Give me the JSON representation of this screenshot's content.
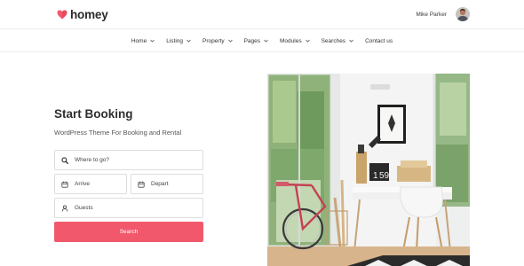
{
  "brand": {
    "name": "homey",
    "accent": "#f1586c"
  },
  "user": {
    "name": "Mike Parker"
  },
  "nav": [
    {
      "label": "Home",
      "has_dropdown": true
    },
    {
      "label": "Listing",
      "has_dropdown": true
    },
    {
      "label": "Property",
      "has_dropdown": true
    },
    {
      "label": "Pages",
      "has_dropdown": true
    },
    {
      "label": "Modules",
      "has_dropdown": true
    },
    {
      "label": "Searches",
      "has_dropdown": true
    },
    {
      "label": "Contact us",
      "has_dropdown": false
    }
  ],
  "booking": {
    "title": "Start Booking",
    "subtitle": "WordPress Theme For Booking and Rental",
    "where_placeholder": "Where to go?",
    "arrive_placeholder": "Arrive",
    "depart_placeholder": "Depart",
    "guests_placeholder": "Guests",
    "search_label": "Search"
  },
  "photo_clock": {
    "hour": "1",
    "minute": "59"
  }
}
